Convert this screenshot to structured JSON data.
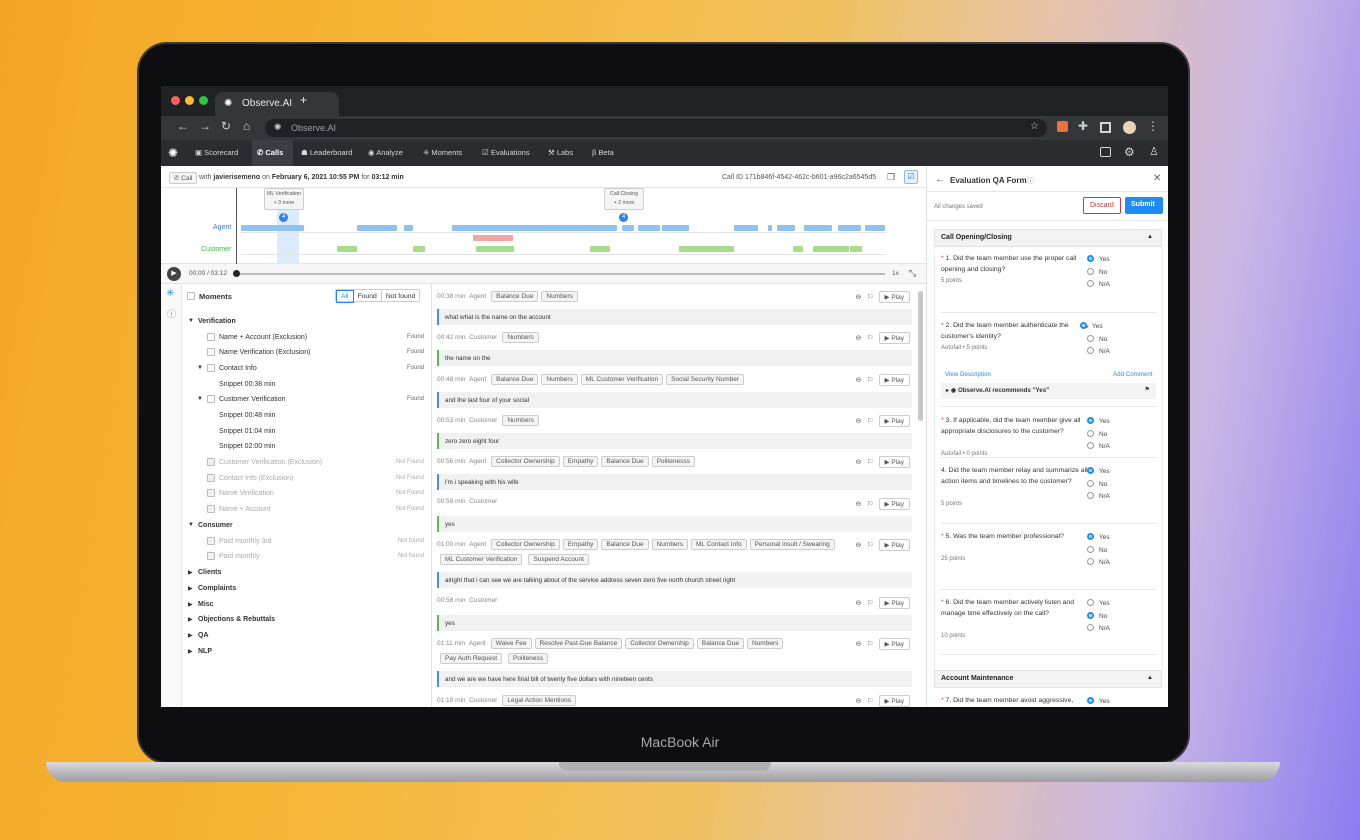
{
  "device": {
    "label": "MacBook Air"
  },
  "browser": {
    "tab_title": "Observe.AI",
    "address": "Observe.AI"
  },
  "nav": {
    "items": [
      "Scorecard",
      "Calls",
      "Leaderboard",
      "Analyze",
      "Moments",
      "Evaluations",
      "Labs",
      "Beta"
    ]
  },
  "call": {
    "badge": "Call",
    "with": "with",
    "agent": "javierisemeno",
    "on": "on",
    "date": "February 6, 2021 10:55 PM",
    "for": "for",
    "duration": "03:12 min",
    "call_id": "Call ID 171b846f-4542-462c-b601-a96c2a6545d5"
  },
  "timeline": {
    "agent_label": "Agent",
    "customer_label": "Customer",
    "marker1_title": "ML Verification",
    "marker1_more": "+ 3 more",
    "marker2_title": "Call Closing",
    "marker2_more": "+ 2 more",
    "marker_count": "4",
    "time": "00:00 / 03:12",
    "speed": "1x"
  },
  "moments": {
    "title": "Moments",
    "filters": [
      "All",
      "Found",
      "Not found"
    ],
    "rows": [
      {
        "label": "Verification",
        "status": ""
      },
      {
        "label": "Name + Account (Exclusion)",
        "status": "Found"
      },
      {
        "label": "Name Verification (Exclusion)",
        "status": "Found"
      },
      {
        "label": "Contact Info",
        "status": "Found"
      },
      {
        "label": "Snippet 00:38 min",
        "status": ""
      },
      {
        "label": "Customer Verification",
        "status": "Found"
      },
      {
        "label": "Snippet 00:48 min",
        "status": ""
      },
      {
        "label": "Snippet 01:04 min",
        "status": ""
      },
      {
        "label": "Snippet 02:00 min",
        "status": ""
      },
      {
        "label": "Customer Verification (Exclusion)",
        "status": "Not Found"
      },
      {
        "label": "Contact Info (Exclusion)",
        "status": "Not Found"
      },
      {
        "label": "Name Verification",
        "status": "Not Found"
      },
      {
        "label": "Name + Account",
        "status": "Not Found"
      },
      {
        "label": "Consumer",
        "status": ""
      },
      {
        "label": "Paid monthly 3rd",
        "status": "Not found"
      },
      {
        "label": "Paid monthly",
        "status": "Not found"
      },
      {
        "label": "Clients",
        "status": ""
      },
      {
        "label": "Complaints",
        "status": ""
      },
      {
        "label": "Misc",
        "status": ""
      },
      {
        "label": "Objections & Rebuttals",
        "status": ""
      },
      {
        "label": "QA",
        "status": ""
      },
      {
        "label": "NLP",
        "status": ""
      }
    ]
  },
  "transcript": {
    "play_label": "Play",
    "utterances": [
      {
        "time": "00:38 min",
        "speaker": "Agent",
        "tags": [
          "Balance Due",
          "Numbers"
        ],
        "tags2": [],
        "text": "what what is the name on the account"
      },
      {
        "time": "00:42 min",
        "speaker": "Customer",
        "tags": [
          "Numbers"
        ],
        "tags2": [],
        "text": "the name on the"
      },
      {
        "time": "00:48 min",
        "speaker": "Agent",
        "tags": [
          "Balance Due",
          "Numbers",
          "ML Customer Verification",
          "Social Security Number"
        ],
        "tags2": [],
        "text": "and the last four of your social"
      },
      {
        "time": "00:53 min",
        "speaker": "Customer",
        "tags": [
          "Numbers"
        ],
        "tags2": [],
        "text": "zero zero eight four"
      },
      {
        "time": "00:56 min",
        "speaker": "Agent",
        "tags": [
          "Collector Ownership",
          "Empathy",
          "Balance Due",
          "Politenesss"
        ],
        "tags2": [],
        "text": "i'm i speaking with his wife"
      },
      {
        "time": "00:58 min",
        "speaker": "Customer",
        "tags": [],
        "tags2": [],
        "text": "yes"
      },
      {
        "time": "01:00 min",
        "speaker": "Agent",
        "tags": [
          "Collector Ownership",
          "Empathy",
          "Balance Due",
          "Numbers",
          "ML Contact Info",
          "Personal insult / Swearing"
        ],
        "tags2": [
          "ML Customer Verification",
          "Suspend Account"
        ],
        "text": "alright that i can see we are talking about of the service address seven zero five north church street right"
      },
      {
        "time": "00:58 min",
        "speaker": "Customer",
        "tags": [],
        "tags2": [],
        "text": "yes"
      },
      {
        "time": "01:11 min",
        "speaker": "Agent",
        "tags": [
          "Waive Fee",
          "Resolve Past-Due Balance",
          "Collector Ownership",
          "Balance Due",
          "Numbers"
        ],
        "tags2": [
          "Pay Auth Request",
          "Politeness"
        ],
        "text": "and we are we have here final bill of twenty five dollars with nineteen cents"
      },
      {
        "time": "01:19 min",
        "speaker": "Customer",
        "tags": [
          "Legal Action Mentions"
        ],
        "tags2": [],
        "text": ""
      }
    ]
  },
  "qa": {
    "title": "Evaluation QA Form",
    "saved": "All changes saved",
    "discard": "Discard",
    "submit": "Submit",
    "section1": "Call Opening/Closing",
    "section2": "Account Maintenance",
    "view_description": "View Description",
    "add_comment": "Add Comment",
    "recommend": "Observe.AI recommends \"Yes\"",
    "questions": [
      {
        "req": "*",
        "text": "1. Did the team member use the proper call opening and closing?",
        "points": "5 points",
        "options": [
          "Yes",
          "No",
          "N/A"
        ],
        "selected": 0
      },
      {
        "req": "*",
        "text": "2. Did the team member authenticate the customer's identity?",
        "points": "Autofail • 5 points",
        "options": [
          "Yes",
          "No",
          "N/A"
        ],
        "selected": 0
      },
      {
        "req": "*",
        "text": "3. If applicable, did the team member give all appropriate disclosures to the customer?",
        "points": "Autofail • 0 points",
        "options": [
          "Yes",
          "No",
          "N/A"
        ],
        "selected": 0
      },
      {
        "req": "",
        "text": "4. Did the team member relay and summarize all action items and timelines to the customer?",
        "points": "5 points",
        "options": [
          "Yes",
          "No",
          "N/A"
        ],
        "selected": 0
      },
      {
        "req": "*",
        "text": "5. Was the team member professional?",
        "points": "25 points",
        "options": [
          "Yes",
          "No",
          "N/A"
        ],
        "selected": 0
      },
      {
        "req": "*",
        "text": "6. Did the team member actively listen and manage time effectively on the call?",
        "points": "10 points",
        "options": [
          "Yes",
          "No",
          "N/A"
        ],
        "selected": 1
      },
      {
        "req": "*",
        "text": "7. Did the team member avoid aggressive,",
        "points": "",
        "options": [
          "Yes"
        ],
        "selected": 0
      }
    ]
  },
  "colors": {
    "agent_bar": "#8ec3f0",
    "customer_bar": "#a6dc8a",
    "highlight_bar": "#f4a3a3",
    "accent": "#1d8cf8"
  }
}
